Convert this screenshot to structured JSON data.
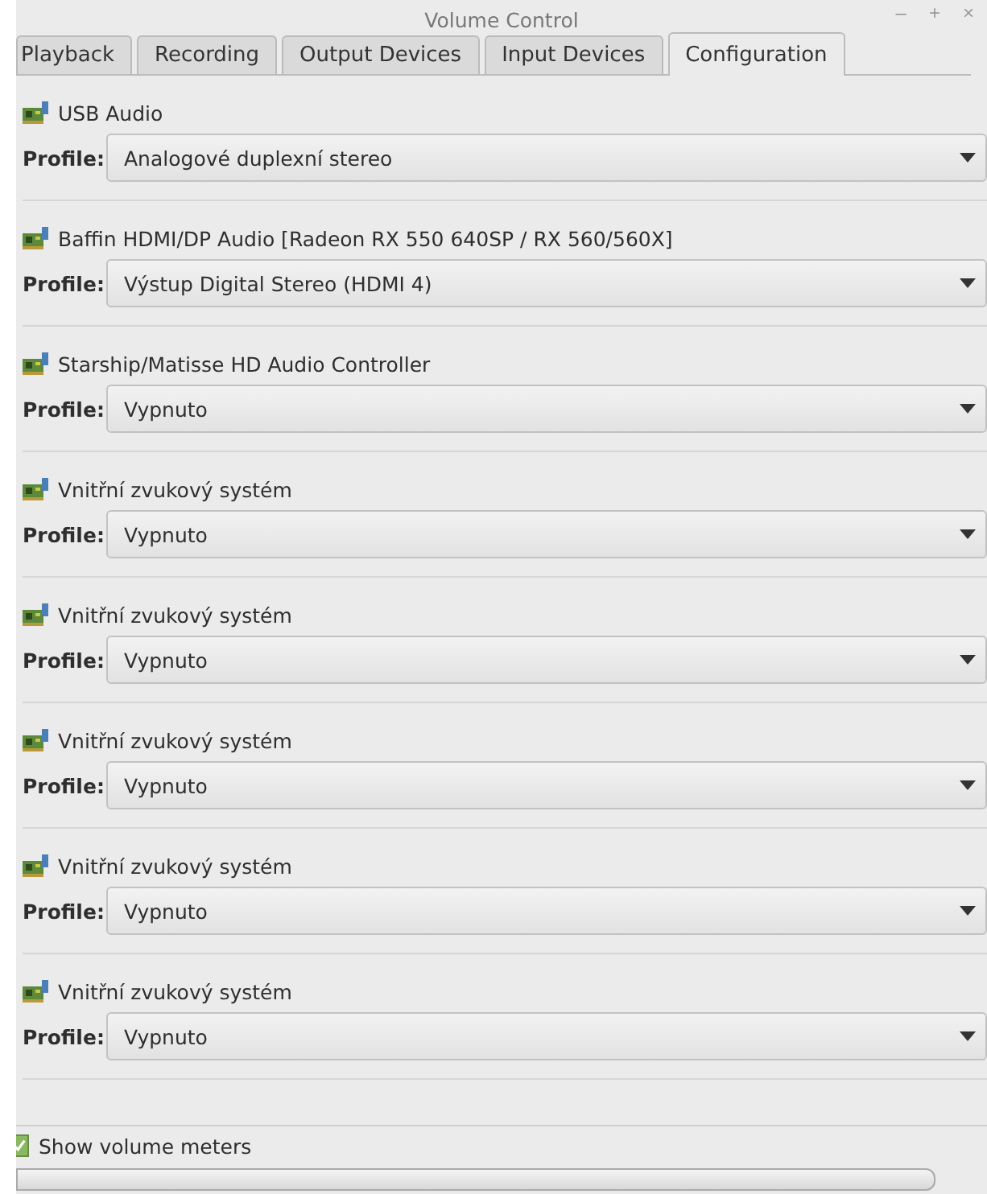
{
  "window": {
    "title": "Volume Control",
    "controls": [
      "–",
      "+",
      "×"
    ]
  },
  "tabs": [
    {
      "label": "Playback",
      "selected": false
    },
    {
      "label": "Recording",
      "selected": false
    },
    {
      "label": "Output Devices",
      "selected": false
    },
    {
      "label": "Input Devices",
      "selected": false
    },
    {
      "label": "Configuration",
      "selected": true
    }
  ],
  "cards": [
    {
      "name": "USB Audio",
      "profile_label": "Profile:",
      "profile": "Analogové duplexní stereo"
    },
    {
      "name": "Baffin HDMI/DP Audio [Radeon RX 550 640SP / RX 560/560X]",
      "profile_label": "Profile:",
      "profile": "Výstup Digital Stereo (HDMI 4)"
    },
    {
      "name": "Starship/Matisse HD Audio Controller",
      "profile_label": "Profile:",
      "profile": "Vypnuto"
    },
    {
      "name": "Vnitřní zvukový systém",
      "profile_label": "Profile:",
      "profile": "Vypnuto"
    },
    {
      "name": "Vnitřní zvukový systém",
      "profile_label": "Profile:",
      "profile": "Vypnuto"
    },
    {
      "name": "Vnitřní zvukový systém",
      "profile_label": "Profile:",
      "profile": "Vypnuto"
    },
    {
      "name": "Vnitřní zvukový systém",
      "profile_label": "Profile:",
      "profile": "Vypnuto"
    },
    {
      "name": "Vnitřní zvukový systém",
      "profile_label": "Profile:",
      "profile": "Vypnuto"
    }
  ],
  "show_meters": {
    "label": "Show volume meters",
    "checked": true
  }
}
